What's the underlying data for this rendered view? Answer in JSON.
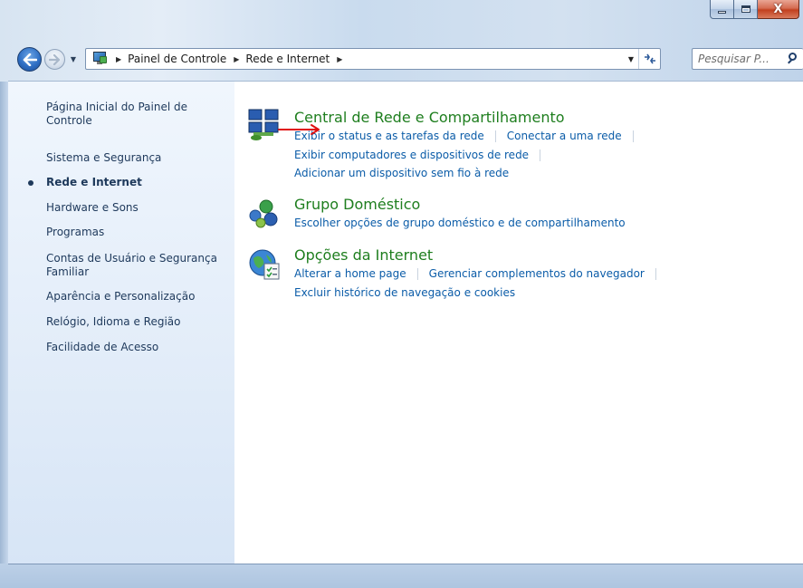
{
  "window": {
    "caption_buttons": {
      "minimize": "minimize",
      "maximize": "maximize",
      "close": "X"
    },
    "colors": {
      "accent": "#1e395b",
      "link": "#0b5ca8",
      "category_title": "#1e7e1e",
      "annotation_arrow": "#e01010"
    }
  },
  "nav": {
    "back_icon": "back-arrow-icon",
    "forward_icon": "forward-arrow-icon",
    "breadcrumb": [
      "Painel de Controle",
      "Rede e Internet"
    ],
    "search_placeholder": "Pesquisar P..."
  },
  "sidebar": {
    "items": [
      {
        "label": "Página Inicial do Painel de Controle",
        "current": false
      },
      {
        "label": "Sistema e Segurança",
        "current": false
      },
      {
        "label": "Rede e Internet",
        "current": true
      },
      {
        "label": "Hardware e Sons",
        "current": false
      },
      {
        "label": "Programas",
        "current": false
      },
      {
        "label": "Contas de Usuário e Segurança Familiar",
        "current": false
      },
      {
        "label": "Aparência e Personalização",
        "current": false
      },
      {
        "label": "Relógio, Idioma e Região",
        "current": false
      },
      {
        "label": "Facilidade de Acesso",
        "current": false
      }
    ]
  },
  "categories": [
    {
      "title": "Central de Rede e Compartilhamento",
      "icon": "network-sharing-center-icon",
      "tasks": [
        "Exibir o status e as tarefas da rede",
        "Conectar a uma rede",
        "Exibir computadores e dispositivos de rede",
        "Adicionar um dispositivo sem fio à rede"
      ]
    },
    {
      "title": "Grupo Doméstico",
      "icon": "homegroup-icon",
      "tasks": [
        "Escolher opções de grupo doméstico e de compartilhamento"
      ]
    },
    {
      "title": "Opções da Internet",
      "icon": "internet-options-icon",
      "tasks": [
        "Alterar a home page",
        "Gerenciar complementos do navegador",
        "Excluir histórico de navegação e cookies"
      ]
    }
  ]
}
